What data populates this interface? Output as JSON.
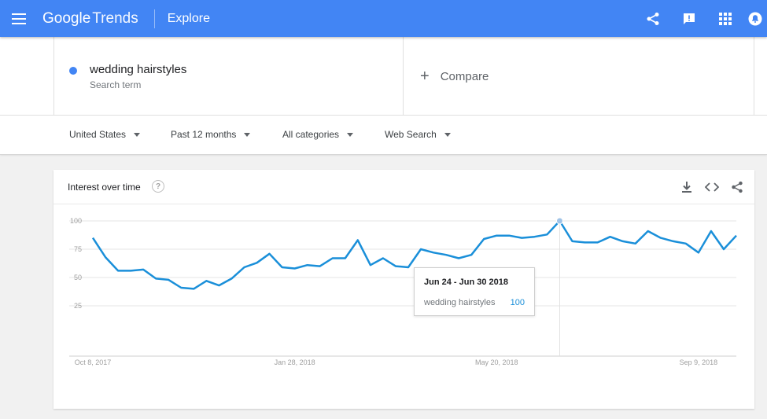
{
  "header": {
    "logo_google": "Google",
    "logo_trends": "Trends",
    "explore": "Explore",
    "color": "#4285f4"
  },
  "search": {
    "term": "wedding hairstyles",
    "term_type": "Search term",
    "term_color": "#4285f4",
    "compare_label": "Compare"
  },
  "filters": {
    "region": "United States",
    "time": "Past 12 months",
    "category": "All categories",
    "property": "Web Search"
  },
  "card": {
    "title": "Interest over time",
    "help": "?"
  },
  "tooltip": {
    "date": "Jun 24 - Jun 30 2018",
    "label": "wedding hairstyles",
    "value": "100"
  },
  "chart_data": {
    "type": "line",
    "title": "",
    "xlabel": "",
    "ylabel": "",
    "ylim": [
      0,
      100
    ],
    "yticks": [
      25,
      50,
      75,
      100
    ],
    "xtick_labels": [
      "Oct 8, 2017",
      "Jan 28, 2018",
      "May 20, 2018",
      "Sep 9, 2018"
    ],
    "xtick_index": [
      0,
      16,
      32,
      48
    ],
    "grid": true,
    "line_color": "#1a8fd9",
    "highlight_index": 37,
    "series": [
      {
        "name": "wedding hairstyles",
        "values": [
          85,
          68,
          56,
          56,
          57,
          49,
          48,
          41,
          40,
          47,
          43,
          49,
          59,
          63,
          71,
          59,
          58,
          61,
          60,
          67,
          67,
          83,
          61,
          67,
          60,
          59,
          75,
          72,
          70,
          67,
          70,
          84,
          87,
          87,
          85,
          86,
          88,
          100,
          82,
          81,
          81,
          86,
          82,
          80,
          91,
          85,
          82,
          80,
          72,
          91,
          75,
          87
        ]
      }
    ]
  }
}
